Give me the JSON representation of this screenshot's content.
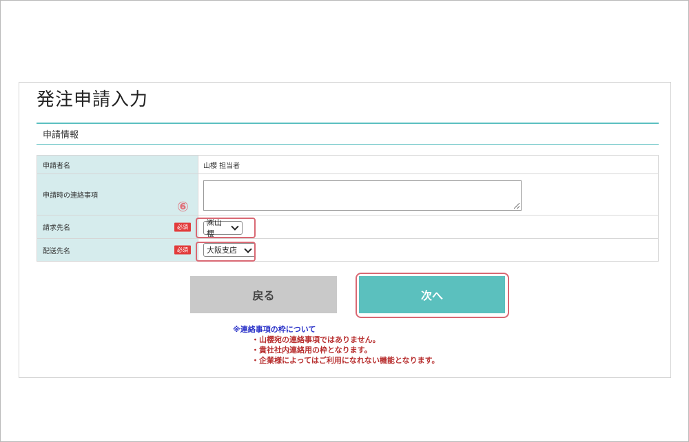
{
  "page": {
    "title": "発注申請入力",
    "section_title": "申請情報"
  },
  "form": {
    "applicant": {
      "label": "申請者名",
      "value": "山櫻 担当者"
    },
    "contact": {
      "label": "申請時の連絡事項",
      "value": ""
    },
    "billing": {
      "label": "請求先名",
      "required": "必須",
      "selected": "㈱山櫻"
    },
    "delivery": {
      "label": "配送先名",
      "required": "必須",
      "selected": "大阪支店"
    }
  },
  "annotation": {
    "step_marker": "⑥",
    "highlight_color": "#d96873"
  },
  "buttons": {
    "back_label": "戻る",
    "next_label": "次へ"
  },
  "notes": {
    "heading": "※連絡事項の枠について",
    "lines": [
      "・山櫻宛の連絡事項ではありません。",
      "・貴社社内連絡用の枠となります。",
      "・企業様によってはご利用になれない機能となります。"
    ]
  },
  "colors": {
    "accent": "#5bc0be",
    "label_bg": "#d6eced",
    "required_badge": "#e23c3c",
    "note_heading": "#2a32c8",
    "note_text": "#b83030"
  }
}
